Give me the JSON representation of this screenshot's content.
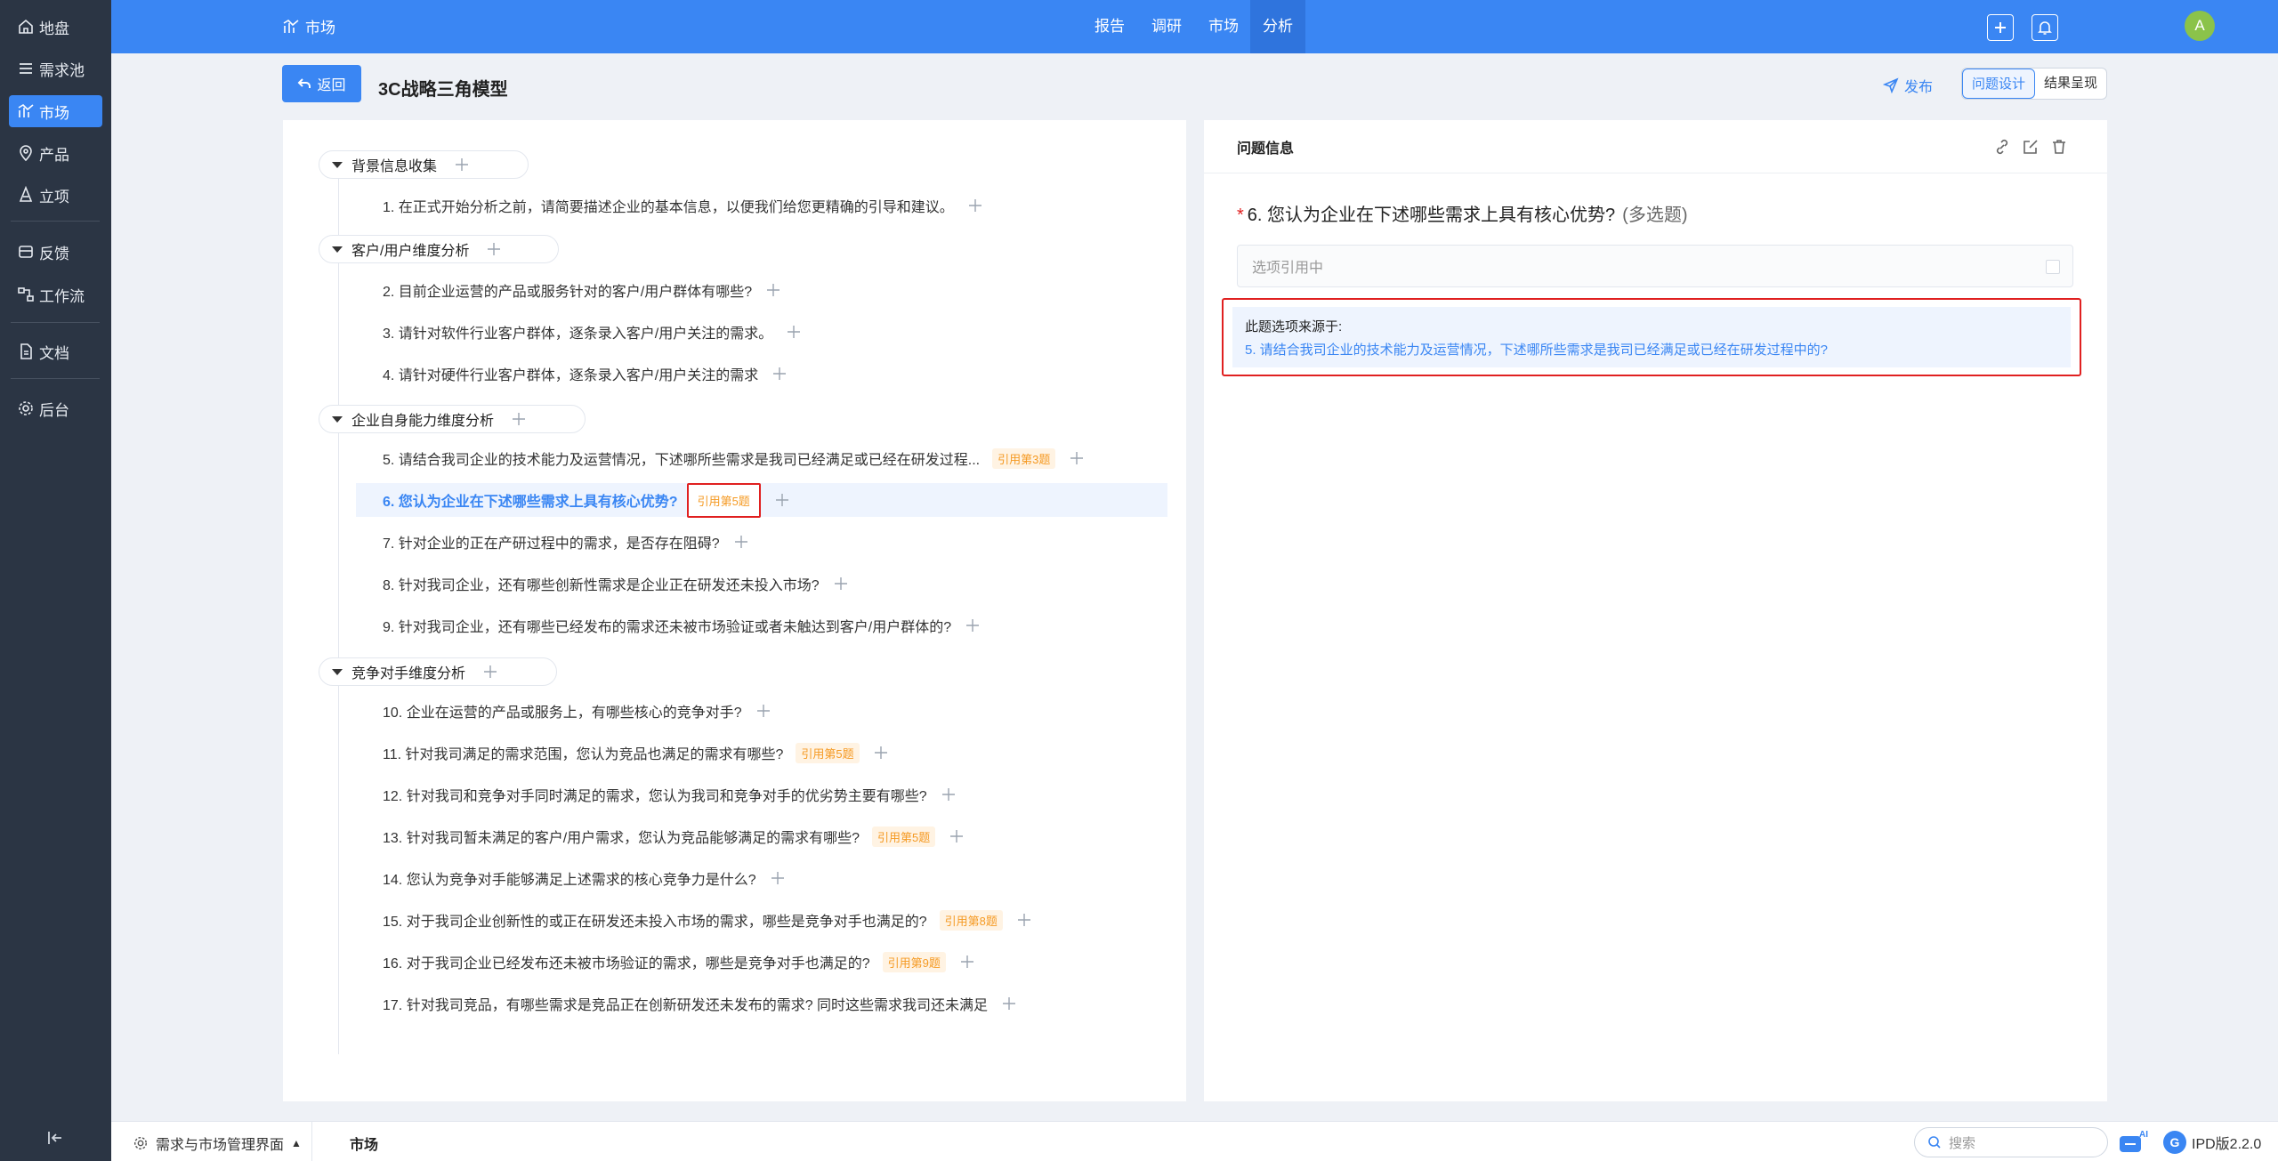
{
  "sidebar": {
    "items": [
      {
        "label": "地盘",
        "icon": "home-icon"
      },
      {
        "label": "需求池",
        "icon": "list-icon"
      },
      {
        "label": "市场",
        "icon": "market-icon"
      },
      {
        "label": "产品",
        "icon": "location-icon"
      },
      {
        "label": "立项",
        "icon": "project-icon"
      },
      {
        "label": "反馈",
        "icon": "feedback-icon"
      },
      {
        "label": "工作流",
        "icon": "workflow-icon"
      },
      {
        "label": "文档",
        "icon": "document-icon"
      },
      {
        "label": "后台",
        "icon": "gear-icon"
      }
    ],
    "active_index": 2
  },
  "topbar": {
    "module": "市场",
    "tabs": [
      "报告",
      "调研",
      "市场",
      "分析"
    ],
    "active_tab": "分析",
    "avatar_letter": "A"
  },
  "page": {
    "back_label": "返回",
    "title": "3C战略三角模型",
    "publish_label": "发布",
    "seg_design": "问题设计",
    "seg_result": "结果呈现"
  },
  "sections": [
    {
      "title": "背景信息收集"
    },
    {
      "title": "客户/用户维度分析"
    },
    {
      "title": "企业自身能力维度分析"
    },
    {
      "title": "竞争对手维度分析"
    }
  ],
  "questions": [
    {
      "text": "1. 在正式开始分析之前，请简要描述企业的基本信息，以便我们给您更精确的引导和建议。",
      "ref": ""
    },
    {
      "text": "2. 目前企业运营的产品或服务针对的客户/用户群体有哪些?",
      "ref": ""
    },
    {
      "text": "3. 请针对软件行业客户群体，逐条录入客户/用户关注的需求。",
      "ref": ""
    },
    {
      "text": "4. 请针对硬件行业客户群体，逐条录入客户/用户关注的需求",
      "ref": ""
    },
    {
      "text": "5. 请结合我司企业的技术能力及运营情况，下述哪所些需求是我司已经满足或已经在研发过程...",
      "ref": "引用第3题"
    },
    {
      "text": "6. 您认为企业在下述哪些需求上具有核心优势?",
      "ref": "引用第5题"
    },
    {
      "text": "7. 针对企业的正在产研过程中的需求，是否存在阻碍?",
      "ref": ""
    },
    {
      "text": "8. 针对我司企业，还有哪些创新性需求是企业正在研发还未投入市场?",
      "ref": ""
    },
    {
      "text": "9. 针对我司企业，还有哪些已经发布的需求还未被市场验证或者未触达到客户/用户群体的?",
      "ref": ""
    },
    {
      "text": "10. 企业在运营的产品或服务上，有哪些核心的竞争对手?",
      "ref": ""
    },
    {
      "text": "11. 针对我司满足的需求范围，您认为竞品也满足的需求有哪些?",
      "ref": "引用第5题"
    },
    {
      "text": "12. 针对我司和竞争对手同时满足的需求，您认为我司和竞争对手的优劣势主要有哪些?",
      "ref": ""
    },
    {
      "text": "13. 针对我司暂未满足的客户/用户需求，您认为竞品能够满足的需求有哪些?",
      "ref": "引用第5题"
    },
    {
      "text": "14. 您认为竞争对手能够满足上述需求的核心竞争力是什么?",
      "ref": ""
    },
    {
      "text": "15. 对于我司企业创新性的或正在研发还未投入市场的需求，哪些是竞争对手也满足的?",
      "ref": "引用第8题"
    },
    {
      "text": "16. 对于我司企业已经发布还未被市场验证的需求，哪些是竞争对手也满足的?",
      "ref": "引用第9题"
    },
    {
      "text": "17. 针对我司竞品，有哪些需求是竞品正在创新研发还未发布的需求? 同时这些需求我司还未满足",
      "ref": ""
    }
  ],
  "detail": {
    "header": "问题信息",
    "question": "6. 您认为企业在下述哪些需求上具有核心优势?",
    "multi_tag": "(多选题)",
    "required_mark": "*",
    "ref_placeholder": "选项引用中",
    "source_label": "此题选项来源于:",
    "source_link": "5. 请结合我司企业的技术能力及运营情况，下述哪所些需求是我司已经满足或已经在研发过程中的?"
  },
  "footer": {
    "module": "需求与市场管理界面",
    "tab": "市场",
    "search_placeholder": "搜索",
    "ai_label": "AI",
    "version": "IPD版2.2.0"
  }
}
